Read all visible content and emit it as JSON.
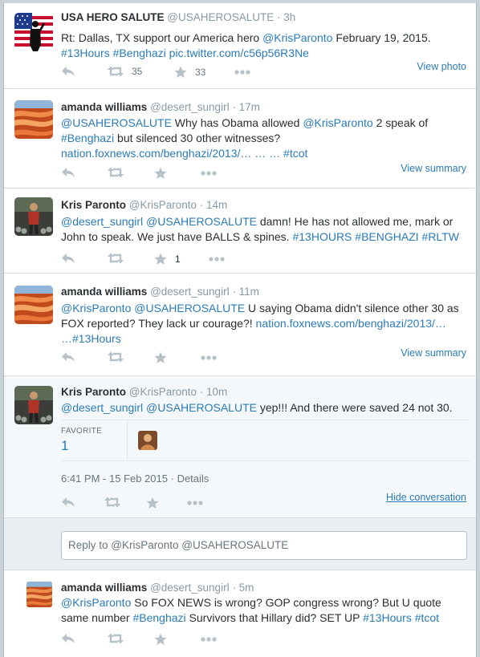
{
  "tweets": [
    {
      "name": "USA HERO SALUTE",
      "handle": "@USAHEROSALUTE",
      "time": "· 3h",
      "segments": [
        {
          "t": "Rt: Dallas, TX support our America hero "
        },
        {
          "t": "@KrisParonto",
          "link": true
        },
        {
          "t": " February 19, 2015.\n"
        },
        {
          "t": "#13Hours",
          "link": true
        },
        {
          "t": " "
        },
        {
          "t": "#Benghazi",
          "link": true
        },
        {
          "t": " "
        },
        {
          "t": "pic.twitter.com/c56p56R3Ne",
          "link": true
        }
      ],
      "retweets": "35",
      "favorites": "33",
      "view_link": "View photo"
    },
    {
      "name": "amanda williams",
      "handle": "@desert_sungirl",
      "time": "· 17m",
      "segments": [
        {
          "t": "@USAHEROSALUTE",
          "link": true
        },
        {
          "t": " Why has Obama allowed "
        },
        {
          "t": "@KrisParonto",
          "link": true
        },
        {
          "t": " 2 speak of\n"
        },
        {
          "t": "#Benghazi",
          "link": true
        },
        {
          "t": " but silenced 30 other witnesses?\n"
        },
        {
          "t": "nation.foxnews.com/benghazi/2013/… … … ",
          "link": true
        },
        {
          "t": "#tcot",
          "link": true
        }
      ],
      "retweets": "",
      "favorites": "",
      "view_link": "View summary"
    },
    {
      "name": "Kris Paronto",
      "handle": "@KrisParonto",
      "time": "· 14m",
      "segments": [
        {
          "t": "@desert_sungirl",
          "link": true
        },
        {
          "t": " "
        },
        {
          "t": "@USAHEROSALUTE",
          "link": true
        },
        {
          "t": " damn! He has not allowed me, mark or\nJohn to speak. We just have BALLS & spines. "
        },
        {
          "t": "#13HOURS",
          "link": true
        },
        {
          "t": " "
        },
        {
          "t": "#BENGHAZI",
          "link": true
        },
        {
          "t": " "
        },
        {
          "t": "#RLTW",
          "link": true
        }
      ],
      "retweets": "",
      "favorites": "1",
      "view_link": ""
    },
    {
      "name": "amanda williams",
      "handle": "@desert_sungirl",
      "time": "· 11m",
      "segments": [
        {
          "t": "@KrisParonto",
          "link": true
        },
        {
          "t": " "
        },
        {
          "t": "@USAHEROSALUTE",
          "link": true
        },
        {
          "t": " U saying Obama didn't silence other 30 as\nFOX reported? They lack ur courage?!  "
        },
        {
          "t": "nation.foxnews.com/benghazi/2013/…\n…",
          "link": true
        },
        {
          "t": "#13Hours",
          "link": true
        }
      ],
      "retweets": "",
      "favorites": "",
      "view_link": "View summary"
    },
    {
      "name": "Kris Paronto",
      "handle": "@KrisParonto",
      "time": "· 10m",
      "segments": [
        {
          "t": "@desert_sungirl",
          "link": true
        },
        {
          "t": " "
        },
        {
          "t": "@USAHEROSALUTE",
          "link": true
        },
        {
          "t": " yep!!! And there were saved 24 not 30."
        }
      ],
      "retweets": "",
      "favorites": "",
      "view_link": "Hide conversation",
      "fav_label": "FAVORITE",
      "fav_count": "1",
      "timestamp": "6:41 PM - 15 Feb 2015",
      "details": "Details"
    },
    {
      "name": "amanda williams",
      "handle": "@desert_sungirl",
      "time": "· 5m",
      "segments": [
        {
          "t": "@KrisParonto",
          "link": true
        },
        {
          "t": " So FOX NEWS is wrong? GOP congress wrong? But U quote\nsame number "
        },
        {
          "t": "#Benghazi",
          "link": true
        },
        {
          "t": " Survivors that Hillary did? SET UP "
        },
        {
          "t": "#13Hours",
          "link": true
        },
        {
          "t": " "
        },
        {
          "t": "#tcot",
          "link": true
        }
      ],
      "retweets": "",
      "favorites": "",
      "view_link": ""
    }
  ],
  "reply": {
    "placeholder": "Reply to @KrisParonto @USAHEROSALUTE"
  },
  "colors": {
    "link": "#2b7bb9",
    "icon": "#b6c1c8",
    "highlight_bg": "#f5f8fa"
  },
  "icons": [
    "reply-icon",
    "retweet-icon",
    "favorite-star-icon",
    "more-dots-icon",
    "hero-salute-avatar",
    "canyon-avatar",
    "runner-avatar"
  ]
}
